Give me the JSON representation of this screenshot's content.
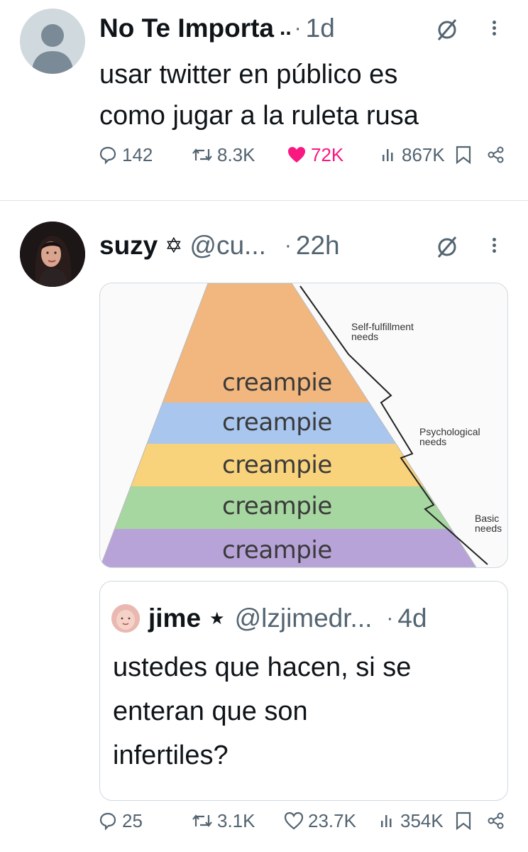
{
  "tweet1": {
    "name": "No Te Importa",
    "name_suffix": "..",
    "sep": "·",
    "time": "1d",
    "text_line1": "usar twitter en público es",
    "text_line2": "como jugar a la ruleta rusa",
    "replies": "142",
    "retweets": "8.3K",
    "likes": "72K",
    "views": "867K",
    "liked_color": "#f91880"
  },
  "tweet2": {
    "name": "suzy",
    "name_symbol": "✡",
    "handle": "@cu...",
    "sep": "·",
    "time": "22h",
    "meme": {
      "tier_label": "creampie",
      "self_label_1": "Self-fulfillment",
      "self_label_2": "needs",
      "psych_label_1": "Psychological",
      "psych_label_2": "needs",
      "basic_label_1": "Basic",
      "basic_label_2": "needs",
      "colors": [
        "#f2b77e",
        "#a9c6ef",
        "#f9d27c",
        "#a6d7a0",
        "#b7a3d8"
      ]
    },
    "quote": {
      "name": "jime",
      "star": "★",
      "handle": "@lzjimedr...",
      "sep": "·",
      "time": "4d",
      "text_line1": "ustedes que hacen, si se",
      "text_line2": "enteran que son",
      "text_line3": "infertiles?"
    },
    "replies": "25",
    "retweets": "3.1K",
    "likes": "23.7K",
    "views": "354K"
  }
}
